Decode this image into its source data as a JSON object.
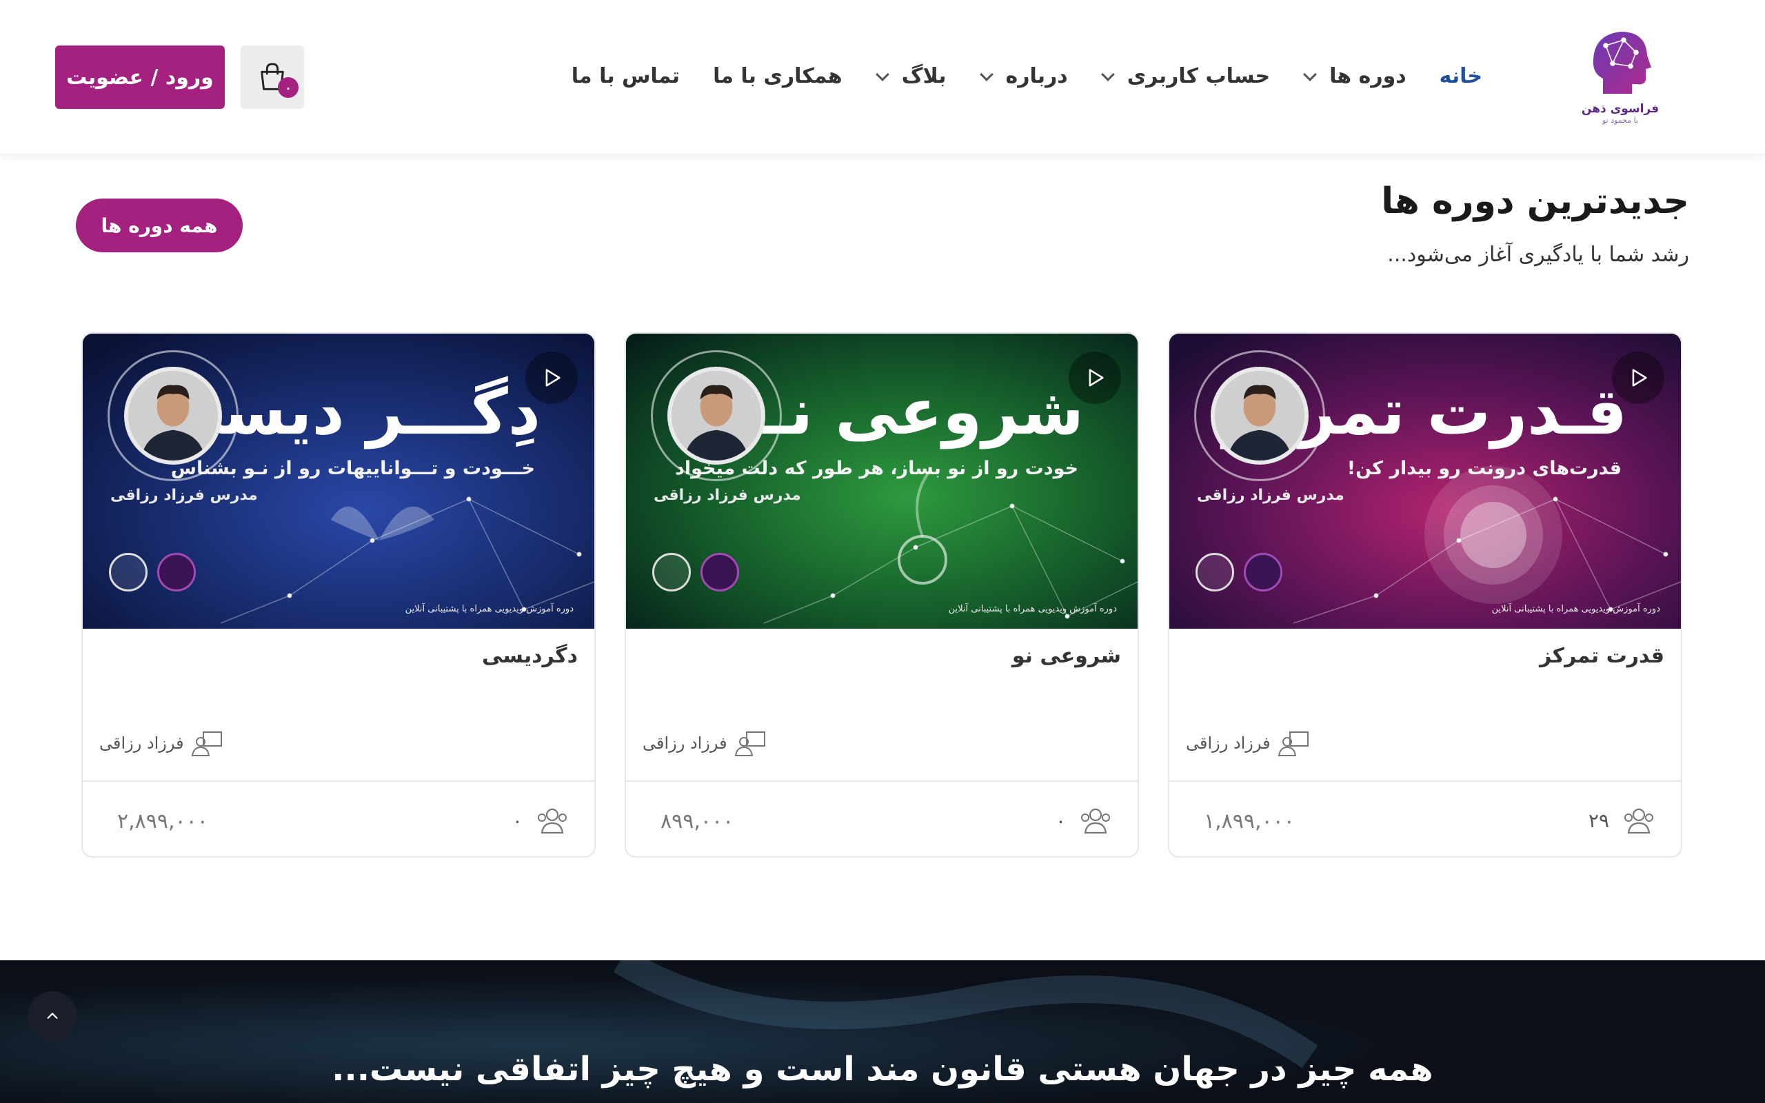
{
  "header": {
    "logo_title": "فراسوی ذهن",
    "logo_sub": "با محمود نو",
    "nav": [
      {
        "label": "خانه",
        "active": true,
        "dropdown": false
      },
      {
        "label": "دوره ها",
        "active": false,
        "dropdown": true
      },
      {
        "label": "حساب کاربری",
        "active": false,
        "dropdown": true
      },
      {
        "label": "درباره",
        "active": false,
        "dropdown": true
      },
      {
        "label": "بلاگ",
        "active": false,
        "dropdown": true
      },
      {
        "label": "همکاری با ما",
        "active": false,
        "dropdown": false
      },
      {
        "label": "تماس با ما",
        "active": false,
        "dropdown": false
      }
    ],
    "cart_count": "۰",
    "login_label": "ورود / عضویت"
  },
  "section": {
    "title": "جدیدترین دوره ها",
    "subtitle": "رشد شما با یادگیری آغاز می‌شود...",
    "all_courses_label": "همه دوره ها"
  },
  "courses": [
    {
      "title": "قدرت تمرکز",
      "image_heading": "قـدرت تمرکز",
      "image_tagline": "قدرت‌های درونت رو بیدار کن!",
      "image_teacher": "مدرس فرزاد رزاقی",
      "image_footer": "دوره آموزش ویدیویی همراه با پشتیبانی آنلاین",
      "instructor": "فرزاد رزاقی",
      "students": "۲۹",
      "price": "۱,۸۹۹,۰۰۰",
      "theme": "#7a1b6c"
    },
    {
      "title": "شروعی نو",
      "image_heading": "شروعی نـــو",
      "image_tagline": "خودت رو از نو بساز، هر طور که دلت میخواد",
      "image_teacher": "مدرس فرزاد رزاقی",
      "image_footer": "دوره آموزش ویدیویی همراه با پشتیبانی آنلاین",
      "instructor": "فرزاد رزاقی",
      "students": "۰",
      "price": "۸۹۹,۰۰۰",
      "theme": "#1f6b2c"
    },
    {
      "title": "دگردیسی",
      "image_heading": "دِگـــر دیسی",
      "image_tagline": "خـــودت و تـــواناییهات رو از نـو بشناس",
      "image_teacher": "مدرس فرزاد رزاقی",
      "image_footer": "دوره آموزش ویدیویی همراه با پشتیبانی آنلاین",
      "instructor": "فرزاد رزاقی",
      "students": "۰",
      "price": "۲,۸۹۹,۰۰۰",
      "theme": "#1b2f6e"
    }
  ],
  "banner": {
    "quote": "همه چیز در جهان هستی قانون مند است و هیچ چیز اتفاقی نیست..."
  },
  "colors": {
    "accent": "#a4217f",
    "nav_active": "#1e4f9a",
    "dark_bg": "#0b0f18"
  }
}
